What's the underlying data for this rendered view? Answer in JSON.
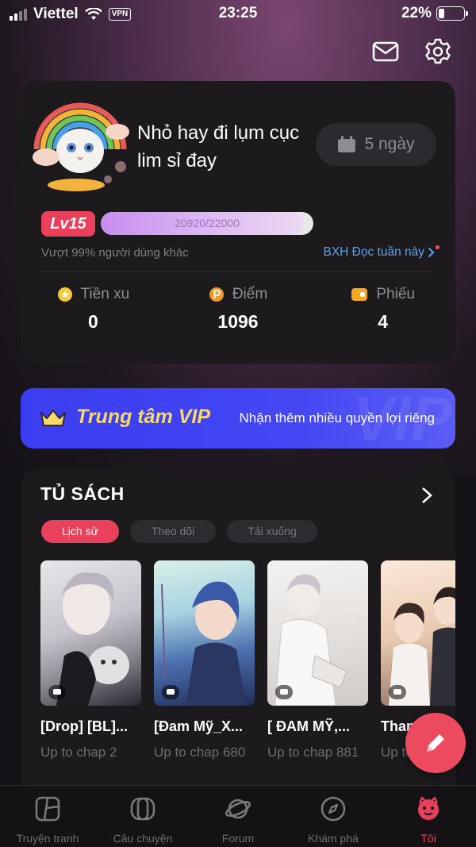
{
  "status_bar": {
    "carrier": "Viettel",
    "vpn": "VPN",
    "time": "23:25",
    "battery": "22%"
  },
  "profile": {
    "username": "Nhỏ hay đi lụm cục lim sỉ đay",
    "streak": "5 ngày",
    "level": "Lv15",
    "xp_text": "20920/22000",
    "xp_progress": 0.951,
    "rank_note": "Vượt 99% người dùng khác",
    "rank_link": "BXH Đọc tuần này",
    "stats": [
      {
        "label": "Tiền xu",
        "value": "0",
        "icon": "coin-icon"
      },
      {
        "label": "Điểm",
        "value": "1096",
        "icon": "points-icon"
      },
      {
        "label": "Phiếu",
        "value": "4",
        "icon": "ticket-icon"
      }
    ]
  },
  "vip": {
    "title": "Trung tâm VIP",
    "subtitle": "Nhận thêm nhiều quyền lợi riêng",
    "watermark": "VIP"
  },
  "shelf": {
    "title": "TỦ SÁCH",
    "chips": [
      "Lịch sử",
      "Theo dõi",
      "Tải xuống"
    ],
    "active_chip": 0,
    "books": [
      {
        "title": "[Drop] [BL]...",
        "progress": "Up to chap 2"
      },
      {
        "title": "[Đam Mỹ_X...",
        "progress": "Up to chap 680"
      },
      {
        "title": "[ ĐAM MỸ,...",
        "progress": "Up to chap 881"
      },
      {
        "title": "Thanh mai...",
        "progress": "Up to chap"
      }
    ]
  },
  "tabs": [
    {
      "label": "Truyện tranh",
      "icon": "comic-icon"
    },
    {
      "label": "Câu chuyện",
      "icon": "story-icon"
    },
    {
      "label": "Forum",
      "icon": "planet-icon"
    },
    {
      "label": "Khám phá",
      "icon": "compass-icon"
    },
    {
      "label": "Tôi",
      "icon": "me-icon"
    }
  ],
  "active_tab": 4,
  "colors": {
    "accent": "#e9415b",
    "vip_blue": "#3b3df0",
    "link_blue": "#5aa4ee",
    "card_bg": "#1c1a1d"
  }
}
